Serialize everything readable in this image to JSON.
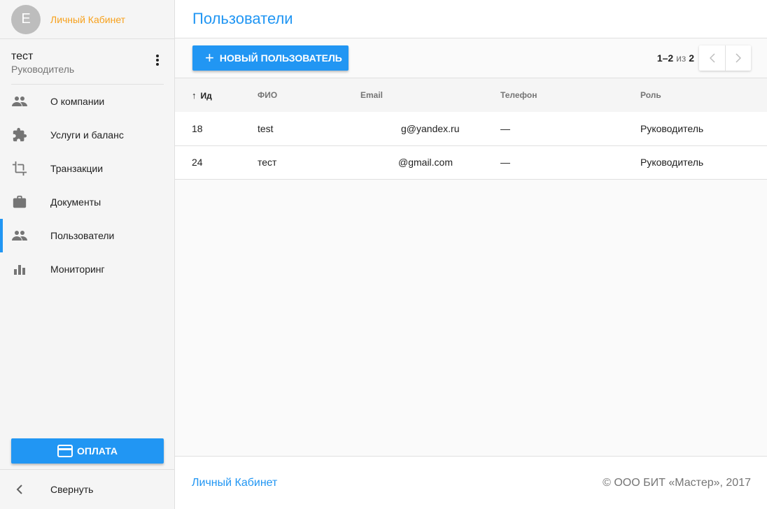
{
  "sidebar": {
    "avatar_letter": "E",
    "brand": "Личный Кабинет",
    "user": {
      "name": "тест",
      "role": "Руководитель"
    },
    "items": [
      {
        "label": "О компании",
        "icon": "people-icon"
      },
      {
        "label": "Услуги и баланс",
        "icon": "puzzle-icon"
      },
      {
        "label": "Транзакции",
        "icon": "crop-icon"
      },
      {
        "label": "Документы",
        "icon": "briefcase-icon"
      },
      {
        "label": "Пользователи",
        "icon": "people-icon",
        "active": true
      },
      {
        "label": "Мониторинг",
        "icon": "bar-chart-icon"
      }
    ],
    "pay_button": "ОПЛАТА",
    "collapse_label": "Свернуть"
  },
  "header": {
    "title": "Пользователи"
  },
  "toolbar": {
    "new_user_button": "НОВЫЙ ПОЛЬЗОВАТЕЛЬ",
    "pager": {
      "range": "1–2",
      "of": "из",
      "total": "2"
    }
  },
  "table": {
    "columns": [
      "Ид",
      "ФИО",
      "Email",
      "Телефон",
      "Роль"
    ],
    "rows": [
      {
        "id": "18",
        "name": "test",
        "email": "g@yandex.ru",
        "phone": "—",
        "role": "Руководитель"
      },
      {
        "id": "24",
        "name": "тест",
        "email": "@gmail.com",
        "phone": "—",
        "role": "Руководитель"
      }
    ]
  },
  "footer": {
    "link": "Личный Кабинет",
    "copyright": "© ООО БИТ «Мастер», 2017"
  },
  "colors": {
    "accent": "#2196f3",
    "brand": "#f7a11c"
  }
}
